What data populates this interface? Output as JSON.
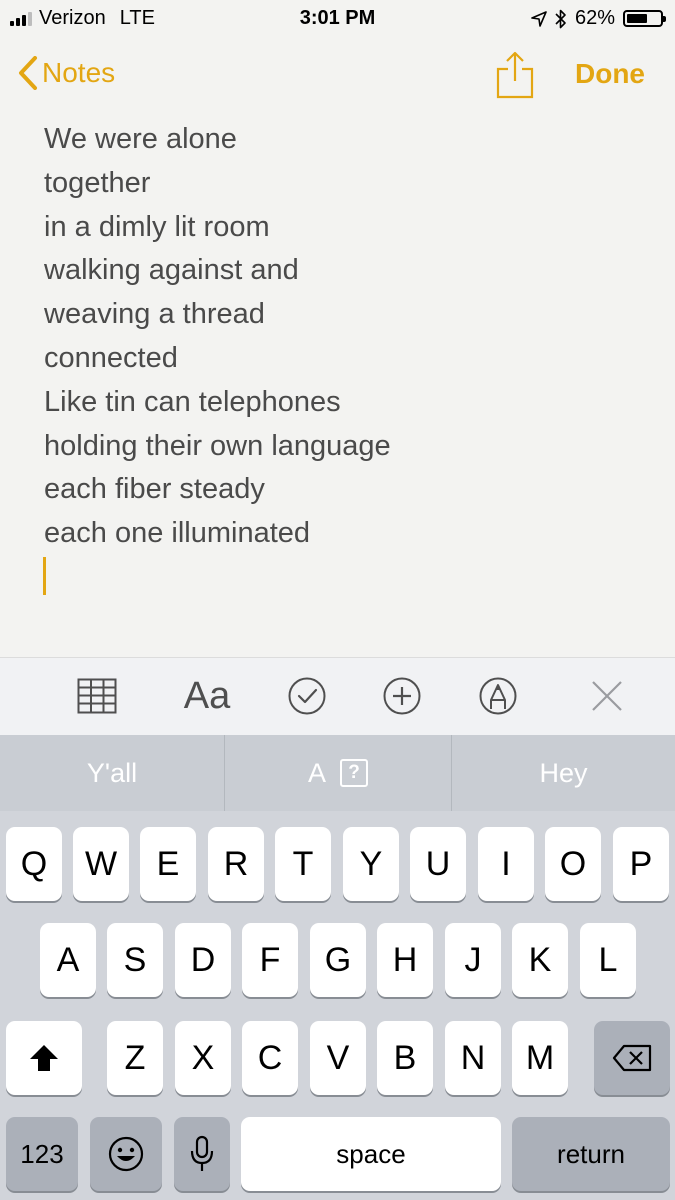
{
  "status_bar": {
    "carrier": "Verizon",
    "network": "LTE",
    "time": "3:01 PM",
    "battery": "62%",
    "battery_level": 0.62,
    "signal_bars_filled": 3,
    "signal_bars_total": 4
  },
  "nav": {
    "back_label": "Notes",
    "done_label": "Done"
  },
  "note": {
    "lines": [
      "We were alone",
      "together",
      "in a dimly lit room",
      "walking against and",
      "weaving a thread",
      "connected",
      "Like tin can telephones",
      "holding their own language",
      "each fiber steady",
      "each one illuminated"
    ]
  },
  "format_toolbar": {
    "text_style_label": "Aa",
    "icons": [
      "table-icon",
      "text-style-icon",
      "checklist-icon",
      "add-icon",
      "markup-icon",
      "close-icon"
    ]
  },
  "predictions": {
    "left": "Y'all",
    "middle": "A",
    "middle_glyph": "?",
    "right": "Hey"
  },
  "keyboard": {
    "row1": [
      "Q",
      "W",
      "E",
      "R",
      "T",
      "Y",
      "U",
      "I",
      "O",
      "P"
    ],
    "row2": [
      "A",
      "S",
      "D",
      "F",
      "G",
      "H",
      "J",
      "K",
      "L"
    ],
    "row3": [
      "Z",
      "X",
      "C",
      "V",
      "B",
      "N",
      "M"
    ],
    "numbers_label": "123",
    "space_label": "space",
    "return_label": "return"
  },
  "colors": {
    "accent": "#e3a613",
    "text": "#4a4a4a",
    "keyboard_bg": "#d1d4da",
    "prediction_bg": "#c9cdd3"
  }
}
